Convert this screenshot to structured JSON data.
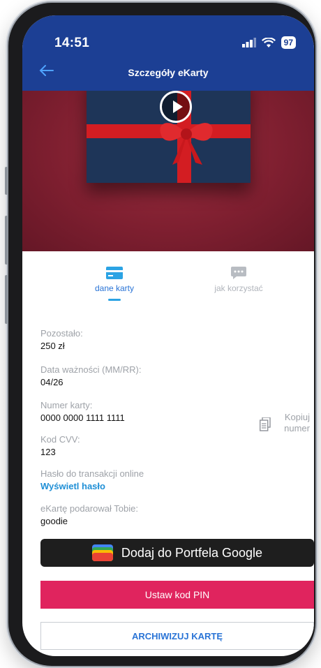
{
  "status": {
    "time": "14:51",
    "battery": "97"
  },
  "nav": {
    "title": "Szczegóły eKarty"
  },
  "tabs": [
    {
      "label": "dane karty",
      "active": true
    },
    {
      "label": "jak korzystać",
      "active": false
    }
  ],
  "fields": {
    "remaining": {
      "label": "Pozostało:",
      "value": "250 zł"
    },
    "expiry": {
      "label": "Data ważności (MM/RR):",
      "value": "04/26"
    },
    "card_number": {
      "label": "Numer karty:",
      "value": "0000 0000 1111 1111"
    },
    "cvv": {
      "label": "Kod CVV:",
      "value": "123"
    },
    "password": {
      "label": "Hasło do transakcji online",
      "link": "Wyświetl hasło"
    },
    "giver": {
      "label": "eKartę podarował Tobie:",
      "value": "goodie"
    }
  },
  "copy": {
    "line1": "Kopiuj",
    "line2": "numer"
  },
  "buttons": {
    "google_wallet": "Dodaj do Portfela Google",
    "set_pin": "Ustaw kod PIN",
    "archive": "ARCHIWIZUJ KARTĘ"
  },
  "colors": {
    "header": "#1c3f94",
    "accent_blue": "#2a74d6",
    "pin_button": "#e0245e",
    "wallet_button": "#1e1e1e",
    "hero_bg": "#7f1f30"
  },
  "icons": [
    "back-arrow-icon",
    "signal-icon",
    "wifi-icon",
    "battery-icon",
    "play-icon",
    "card-icon",
    "chat-icon",
    "copy-icon",
    "google-wallet-icon"
  ]
}
